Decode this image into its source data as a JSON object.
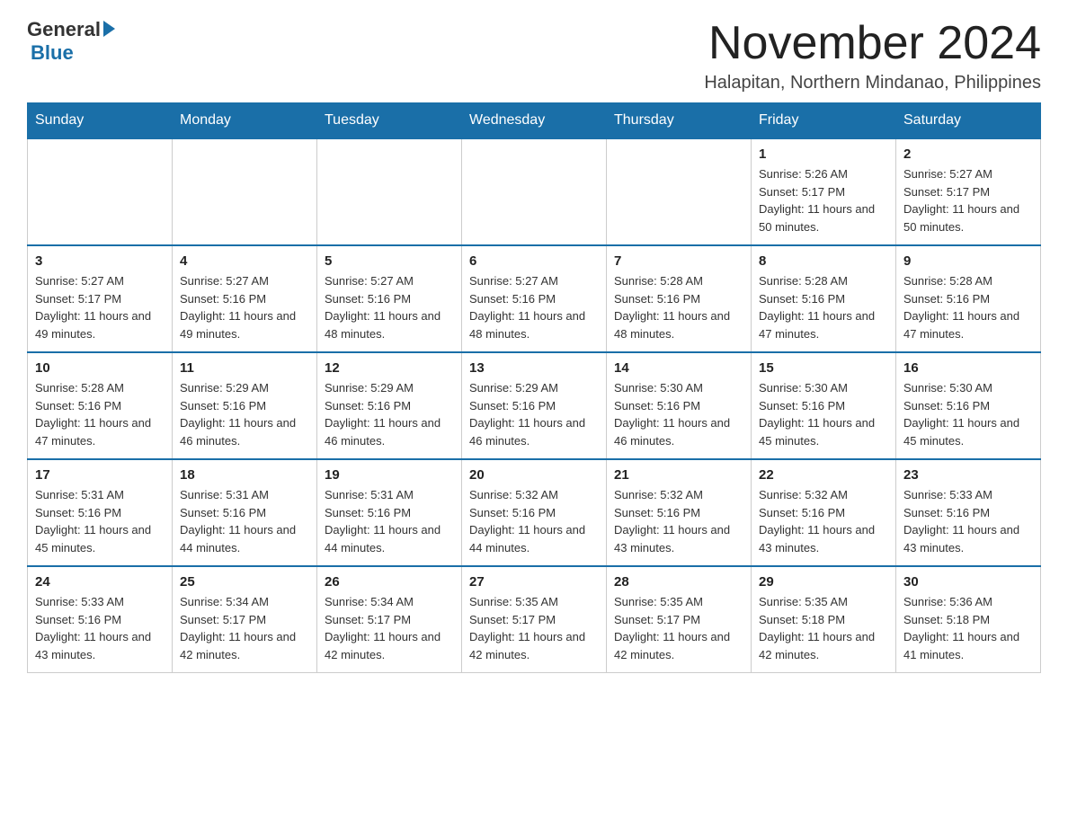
{
  "logo": {
    "general": "General",
    "blue": "Blue"
  },
  "title": "November 2024",
  "location": "Halapitan, Northern Mindanao, Philippines",
  "days_of_week": [
    "Sunday",
    "Monday",
    "Tuesday",
    "Wednesday",
    "Thursday",
    "Friday",
    "Saturday"
  ],
  "weeks": [
    [
      {
        "day": "",
        "info": ""
      },
      {
        "day": "",
        "info": ""
      },
      {
        "day": "",
        "info": ""
      },
      {
        "day": "",
        "info": ""
      },
      {
        "day": "",
        "info": ""
      },
      {
        "day": "1",
        "info": "Sunrise: 5:26 AM\nSunset: 5:17 PM\nDaylight: 11 hours and 50 minutes."
      },
      {
        "day": "2",
        "info": "Sunrise: 5:27 AM\nSunset: 5:17 PM\nDaylight: 11 hours and 50 minutes."
      }
    ],
    [
      {
        "day": "3",
        "info": "Sunrise: 5:27 AM\nSunset: 5:17 PM\nDaylight: 11 hours and 49 minutes."
      },
      {
        "day": "4",
        "info": "Sunrise: 5:27 AM\nSunset: 5:16 PM\nDaylight: 11 hours and 49 minutes."
      },
      {
        "day": "5",
        "info": "Sunrise: 5:27 AM\nSunset: 5:16 PM\nDaylight: 11 hours and 48 minutes."
      },
      {
        "day": "6",
        "info": "Sunrise: 5:27 AM\nSunset: 5:16 PM\nDaylight: 11 hours and 48 minutes."
      },
      {
        "day": "7",
        "info": "Sunrise: 5:28 AM\nSunset: 5:16 PM\nDaylight: 11 hours and 48 minutes."
      },
      {
        "day": "8",
        "info": "Sunrise: 5:28 AM\nSunset: 5:16 PM\nDaylight: 11 hours and 47 minutes."
      },
      {
        "day": "9",
        "info": "Sunrise: 5:28 AM\nSunset: 5:16 PM\nDaylight: 11 hours and 47 minutes."
      }
    ],
    [
      {
        "day": "10",
        "info": "Sunrise: 5:28 AM\nSunset: 5:16 PM\nDaylight: 11 hours and 47 minutes."
      },
      {
        "day": "11",
        "info": "Sunrise: 5:29 AM\nSunset: 5:16 PM\nDaylight: 11 hours and 46 minutes."
      },
      {
        "day": "12",
        "info": "Sunrise: 5:29 AM\nSunset: 5:16 PM\nDaylight: 11 hours and 46 minutes."
      },
      {
        "day": "13",
        "info": "Sunrise: 5:29 AM\nSunset: 5:16 PM\nDaylight: 11 hours and 46 minutes."
      },
      {
        "day": "14",
        "info": "Sunrise: 5:30 AM\nSunset: 5:16 PM\nDaylight: 11 hours and 46 minutes."
      },
      {
        "day": "15",
        "info": "Sunrise: 5:30 AM\nSunset: 5:16 PM\nDaylight: 11 hours and 45 minutes."
      },
      {
        "day": "16",
        "info": "Sunrise: 5:30 AM\nSunset: 5:16 PM\nDaylight: 11 hours and 45 minutes."
      }
    ],
    [
      {
        "day": "17",
        "info": "Sunrise: 5:31 AM\nSunset: 5:16 PM\nDaylight: 11 hours and 45 minutes."
      },
      {
        "day": "18",
        "info": "Sunrise: 5:31 AM\nSunset: 5:16 PM\nDaylight: 11 hours and 44 minutes."
      },
      {
        "day": "19",
        "info": "Sunrise: 5:31 AM\nSunset: 5:16 PM\nDaylight: 11 hours and 44 minutes."
      },
      {
        "day": "20",
        "info": "Sunrise: 5:32 AM\nSunset: 5:16 PM\nDaylight: 11 hours and 44 minutes."
      },
      {
        "day": "21",
        "info": "Sunrise: 5:32 AM\nSunset: 5:16 PM\nDaylight: 11 hours and 43 minutes."
      },
      {
        "day": "22",
        "info": "Sunrise: 5:32 AM\nSunset: 5:16 PM\nDaylight: 11 hours and 43 minutes."
      },
      {
        "day": "23",
        "info": "Sunrise: 5:33 AM\nSunset: 5:16 PM\nDaylight: 11 hours and 43 minutes."
      }
    ],
    [
      {
        "day": "24",
        "info": "Sunrise: 5:33 AM\nSunset: 5:16 PM\nDaylight: 11 hours and 43 minutes."
      },
      {
        "day": "25",
        "info": "Sunrise: 5:34 AM\nSunset: 5:17 PM\nDaylight: 11 hours and 42 minutes."
      },
      {
        "day": "26",
        "info": "Sunrise: 5:34 AM\nSunset: 5:17 PM\nDaylight: 11 hours and 42 minutes."
      },
      {
        "day": "27",
        "info": "Sunrise: 5:35 AM\nSunset: 5:17 PM\nDaylight: 11 hours and 42 minutes."
      },
      {
        "day": "28",
        "info": "Sunrise: 5:35 AM\nSunset: 5:17 PM\nDaylight: 11 hours and 42 minutes."
      },
      {
        "day": "29",
        "info": "Sunrise: 5:35 AM\nSunset: 5:18 PM\nDaylight: 11 hours and 42 minutes."
      },
      {
        "day": "30",
        "info": "Sunrise: 5:36 AM\nSunset: 5:18 PM\nDaylight: 11 hours and 41 minutes."
      }
    ]
  ]
}
